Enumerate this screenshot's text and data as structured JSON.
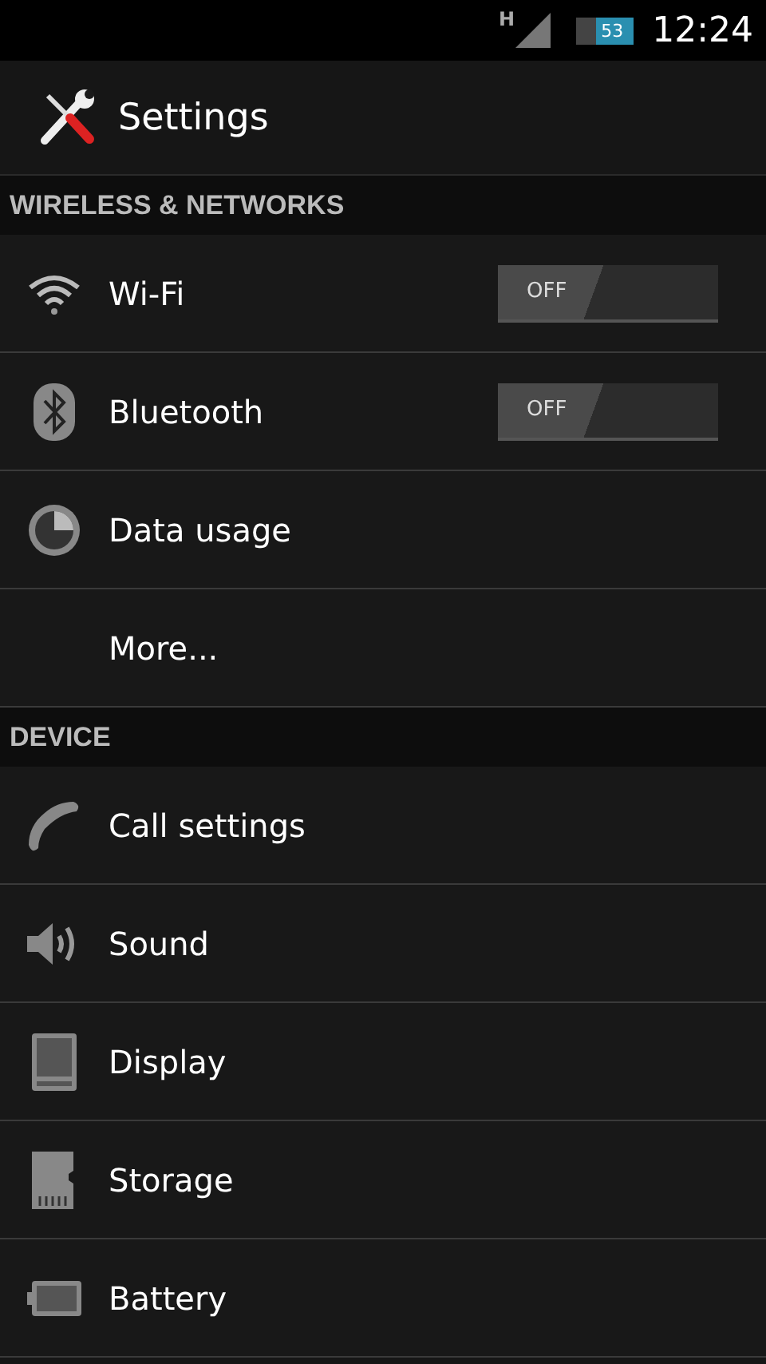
{
  "status_bar": {
    "network": "H",
    "battery": "53",
    "time": "12:24"
  },
  "header": {
    "title": "Settings"
  },
  "sections": [
    {
      "title": "WIRELESS & NETWORKS",
      "items": [
        {
          "label": "Wi-Fi",
          "kind": "toggle",
          "toggle": {
            "label": "OFF",
            "on": false
          }
        },
        {
          "label": "Bluetooth",
          "kind": "toggle",
          "toggle": {
            "label": "OFF",
            "on": false
          }
        },
        {
          "label": "Data usage",
          "kind": "plain"
        },
        {
          "label": "More...",
          "kind": "plain"
        }
      ]
    },
    {
      "title": "DEVICE",
      "items": [
        {
          "label": "Call settings",
          "kind": "plain"
        },
        {
          "label": "Sound",
          "kind": "plain"
        },
        {
          "label": "Display",
          "kind": "plain"
        },
        {
          "label": "Storage",
          "kind": "plain"
        },
        {
          "label": "Battery",
          "kind": "plain"
        }
      ]
    }
  ]
}
